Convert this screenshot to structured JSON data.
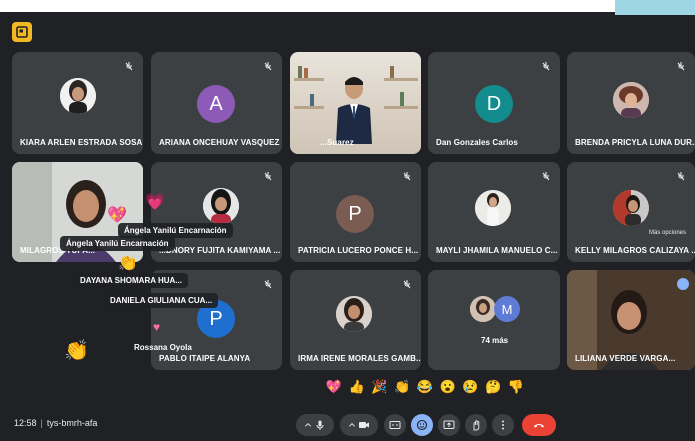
{
  "meeting": {
    "time": "12:58",
    "code": "tys-bmrh-afa"
  },
  "colors": {
    "tile": "#3c4043",
    "background": "#202124",
    "avatar_purple": "#8e5ab8",
    "avatar_teal": "#128c8c",
    "avatar_brown": "#7a5c52",
    "avatar_blue": "#1f6fd1",
    "active_speaker": "#8ab4f8",
    "end_call": "#ea4335"
  },
  "participants": [
    {
      "name": "KIARA ARLEN ESTRADA SOSA"
    },
    {
      "name": "ARIANA ONCEHUAY VASQUEZ",
      "initial": "A"
    },
    {
      "name": "...Suarez"
    },
    {
      "name": "Dan Gonzales Carlos",
      "initial": "D"
    },
    {
      "name": "BRENDA PRICYLA LUNA DUR..."
    },
    {
      "name": "MILAGROS YUPA..."
    },
    {
      "name": "...DNORY FUJITA KAMIYAMA ..."
    },
    {
      "name": "PATRICIA LUCERO PONCE H...",
      "initial": "P"
    },
    {
      "name": "MAYLI JHAMILA MANUELO C..."
    },
    {
      "name": "KELLY MILAGROS CALIZAYA ...",
      "sub": "Más opciones"
    },
    {
      "name": "PABLO ITAIPE ALANYA",
      "initial": "P"
    },
    {
      "name": "IRMA IRENE MORALES GAMB..."
    },
    {
      "name": "74 más",
      "initial": "M"
    },
    {
      "name": "LILIANA VERDE VARGA..."
    }
  ],
  "overlays": {
    "angela_1": "Ángela Yanilú Encarnación",
    "angela_2": "Ángela Yanilú Encarnación",
    "dayana": "DAYANA SHOMARA HUA...",
    "daniela": "DANIELA GIULIANA CUA...",
    "rossana": "Rossana Oyola"
  },
  "reactions": [
    "💖",
    "👍",
    "🎉",
    "👏",
    "😂",
    "😮",
    "😢",
    "🤔",
    "👎"
  ]
}
